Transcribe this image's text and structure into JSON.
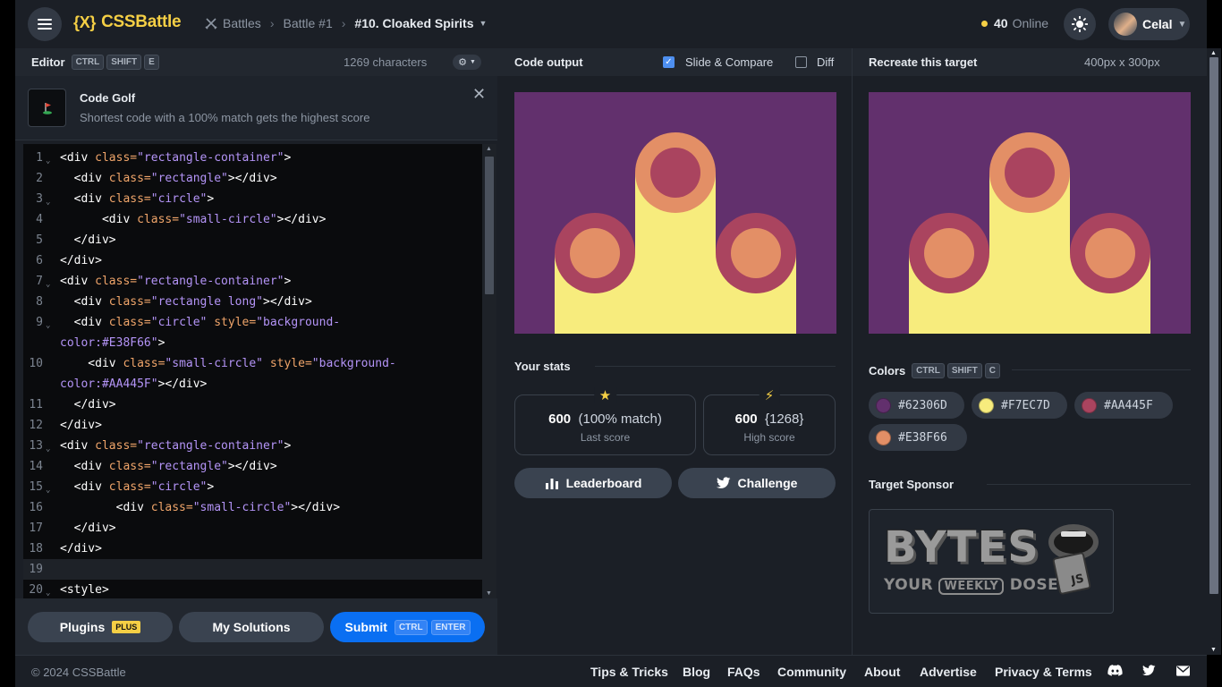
{
  "header": {
    "logo_mark": "{X}",
    "logo_text": "CSSBattle",
    "crumbs": [
      "Battles",
      "Battle #1",
      "#10. Cloaked Spirits"
    ],
    "online_count": "40",
    "online_label": "Online",
    "user_name": "Celal"
  },
  "editor": {
    "title": "Editor",
    "keys": [
      "CTRL",
      "SHIFT",
      "E"
    ],
    "chars": "1269 characters",
    "golf_title": "Code Golf",
    "golf_desc": "Shortest code with a 100% match gets the highest score",
    "lines": [
      {
        "n": "1",
        "fold": true,
        "segs": [
          [
            "t",
            "<div "
          ],
          [
            "a",
            "class="
          ],
          [
            "s",
            "\"rectangle-container\""
          ],
          [
            "t",
            ">"
          ]
        ]
      },
      {
        "n": "2",
        "fold": false,
        "segs": [
          [
            "t",
            "  <div "
          ],
          [
            "a",
            "class="
          ],
          [
            "s",
            "\"rectangle\""
          ],
          [
            "t",
            "></div>"
          ]
        ]
      },
      {
        "n": "3",
        "fold": true,
        "segs": [
          [
            "t",
            "  <div "
          ],
          [
            "a",
            "class="
          ],
          [
            "s",
            "\"circle\""
          ],
          [
            "t",
            ">"
          ]
        ]
      },
      {
        "n": "4",
        "fold": false,
        "segs": [
          [
            "t",
            "      <div "
          ],
          [
            "a",
            "class="
          ],
          [
            "s",
            "\"small-circle\""
          ],
          [
            "t",
            "></div>"
          ]
        ]
      },
      {
        "n": "5",
        "fold": false,
        "segs": [
          [
            "t",
            "  </div>"
          ]
        ]
      },
      {
        "n": "6",
        "fold": false,
        "segs": [
          [
            "t",
            "</div>"
          ]
        ]
      },
      {
        "n": "7",
        "fold": true,
        "segs": [
          [
            "t",
            "<div "
          ],
          [
            "a",
            "class="
          ],
          [
            "s",
            "\"rectangle-container\""
          ],
          [
            "t",
            ">"
          ]
        ]
      },
      {
        "n": "8",
        "fold": false,
        "segs": [
          [
            "t",
            "  <div "
          ],
          [
            "a",
            "class="
          ],
          [
            "s",
            "\"rectangle long\""
          ],
          [
            "t",
            "></div>"
          ]
        ]
      },
      {
        "n": "9",
        "fold": true,
        "segs": [
          [
            "t",
            "  <div "
          ],
          [
            "a",
            "class="
          ],
          [
            "s",
            "\"circle\" "
          ],
          [
            "a",
            "style="
          ],
          [
            "s",
            "\"background-"
          ]
        ]
      },
      {
        "n": "",
        "fold": false,
        "segs": [
          [
            "s",
            "color:#E38F66\""
          ],
          [
            "t",
            ">"
          ]
        ]
      },
      {
        "n": "10",
        "fold": false,
        "segs": [
          [
            "t",
            "    <div "
          ],
          [
            "a",
            "class="
          ],
          [
            "s",
            "\"small-circle\" "
          ],
          [
            "a",
            "style="
          ],
          [
            "s",
            "\"background-"
          ]
        ]
      },
      {
        "n": "",
        "fold": false,
        "segs": [
          [
            "s",
            "color:#AA445F\""
          ],
          [
            "t",
            "></div>"
          ]
        ]
      },
      {
        "n": "11",
        "fold": false,
        "segs": [
          [
            "t",
            "  </div>"
          ]
        ]
      },
      {
        "n": "12",
        "fold": false,
        "segs": [
          [
            "t",
            "</div>"
          ]
        ]
      },
      {
        "n": "13",
        "fold": true,
        "segs": [
          [
            "t",
            "<div "
          ],
          [
            "a",
            "class="
          ],
          [
            "s",
            "\"rectangle-container\""
          ],
          [
            "t",
            ">"
          ]
        ]
      },
      {
        "n": "14",
        "fold": false,
        "segs": [
          [
            "t",
            "  <div "
          ],
          [
            "a",
            "class="
          ],
          [
            "s",
            "\"rectangle\""
          ],
          [
            "t",
            "></div>"
          ]
        ]
      },
      {
        "n": "15",
        "fold": true,
        "segs": [
          [
            "t",
            "  <div "
          ],
          [
            "a",
            "class="
          ],
          [
            "s",
            "\"circle\""
          ],
          [
            "t",
            ">"
          ]
        ]
      },
      {
        "n": "16",
        "fold": false,
        "segs": [
          [
            "t",
            "        <div "
          ],
          [
            "a",
            "class="
          ],
          [
            "s",
            "\"small-circle\""
          ],
          [
            "t",
            "></div>"
          ]
        ]
      },
      {
        "n": "17",
        "fold": false,
        "segs": [
          [
            "t",
            "  </div>"
          ]
        ]
      },
      {
        "n": "18",
        "fold": false,
        "segs": [
          [
            "t",
            "</div>"
          ]
        ]
      },
      {
        "n": "19",
        "fold": false,
        "active": true,
        "segs": []
      },
      {
        "n": "20",
        "fold": true,
        "segs": [
          [
            "t",
            "<style>"
          ]
        ]
      }
    ],
    "plugins_label": "Plugins",
    "plus_badge": "PLUS",
    "solutions_label": "My Solutions",
    "submit_label": "Submit",
    "submit_keys": [
      "CTRL",
      "ENTER"
    ]
  },
  "output": {
    "title": "Code output",
    "slide_label": "Slide & Compare",
    "slide_checked": true,
    "diff_label": "Diff",
    "diff_checked": false,
    "stats_title": "Your stats",
    "last_score": "600",
    "last_match": "(100% match)",
    "last_label": "Last score",
    "high_score": "600",
    "high_chars": "{1268}",
    "high_label": "High score",
    "leaderboard_label": "Leaderboard",
    "challenge_label": "Challenge"
  },
  "target": {
    "title": "Recreate this target",
    "size": "400px x 300px",
    "colors_title": "Colors",
    "colors_keys": [
      "CTRL",
      "SHIFT",
      "C"
    ],
    "colors": [
      "#62306D",
      "#F7EC7D",
      "#AA445F",
      "#E38F66"
    ],
    "sponsor_title": "Target Sponsor",
    "sponsor_word": "BYTES",
    "sponsor_tag_1": "YOUR",
    "sponsor_tag_2": "WEEKLY",
    "sponsor_tag_3": "DOSE OF",
    "sponsor_badge": "JS"
  },
  "footer": {
    "copyright": "© 2024 CSSBattle",
    "links": [
      "Tips & Tricks",
      "Blog",
      "FAQs",
      "Community",
      "About",
      "Advertise",
      "Privacy & Terms"
    ]
  }
}
